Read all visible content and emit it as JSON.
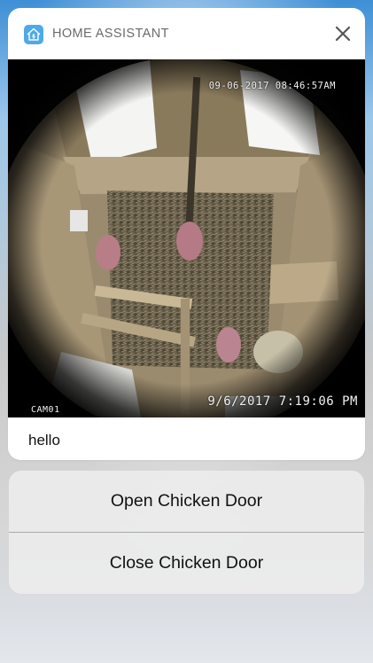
{
  "notification": {
    "app_icon": "home-assistant-icon",
    "app_name": "HOME ASSISTANT",
    "close_icon": "close-icon",
    "message": "hello",
    "camera": {
      "timestamp_top": "09-06-2017 08:46:57AM",
      "timestamp_bottom": "9/6/2017 7:19:06 PM",
      "camera_label": "CAM01"
    }
  },
  "actions": [
    {
      "label": "Open Chicken Door"
    },
    {
      "label": "Close Chicken Door"
    }
  ]
}
